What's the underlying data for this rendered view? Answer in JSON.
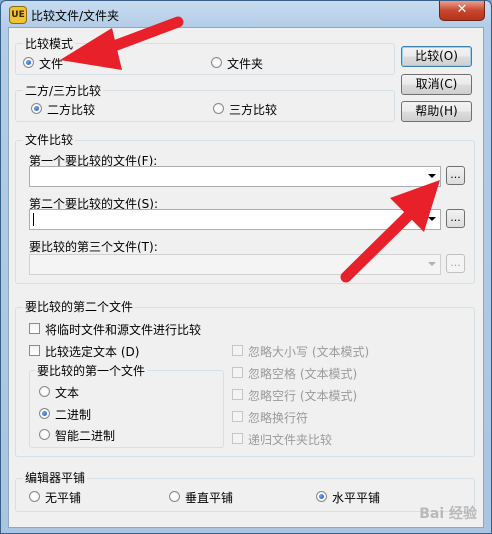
{
  "window": {
    "title": "比较文件/文件夹",
    "close_label": "✕",
    "app_icon_label": "UE"
  },
  "buttons": {
    "compare": "比较(O)",
    "cancel": "取消(C)",
    "help": "帮助(H)"
  },
  "compare_mode": {
    "label": "比较模式",
    "options": [
      "文件",
      "文件夹"
    ],
    "selected": "文件"
  },
  "two_three": {
    "label": "二方/三方比较",
    "options": [
      "二方比较",
      "三方比较"
    ],
    "selected": "二方比较"
  },
  "file_compare": {
    "label": "文件比较",
    "first_label": "第一个要比较的文件(F):",
    "first_value": "",
    "second_label": "第二个要比较的文件(S):",
    "second_value": "",
    "third_label": "要比较的第三个文件(T):",
    "third_value": "",
    "browse_label": "..."
  },
  "second_file_group": {
    "label": "要比较的第二个文件",
    "check_temp": "将临时文件和源文件进行比较",
    "check_selected": "比较选定文本 (D)",
    "first_file_group": {
      "label": "要比较的第一个文件",
      "options": [
        "文本",
        "二进制",
        "智能二进制"
      ],
      "selected": "二进制"
    },
    "options_disabled": [
      "忽略大小写 (文本模式)",
      "忽略空格 (文本模式)",
      "忽略空行 (文本模式)",
      "忽略换行符",
      "递归文件夹比较"
    ]
  },
  "tiling": {
    "label": "编辑器平铺",
    "options": [
      "无平铺",
      "垂直平铺",
      "水平平铺"
    ],
    "selected": "水平平铺"
  },
  "watermark": "Bai 经验",
  "colors": {
    "annotation_arrow": "#e8202a"
  }
}
